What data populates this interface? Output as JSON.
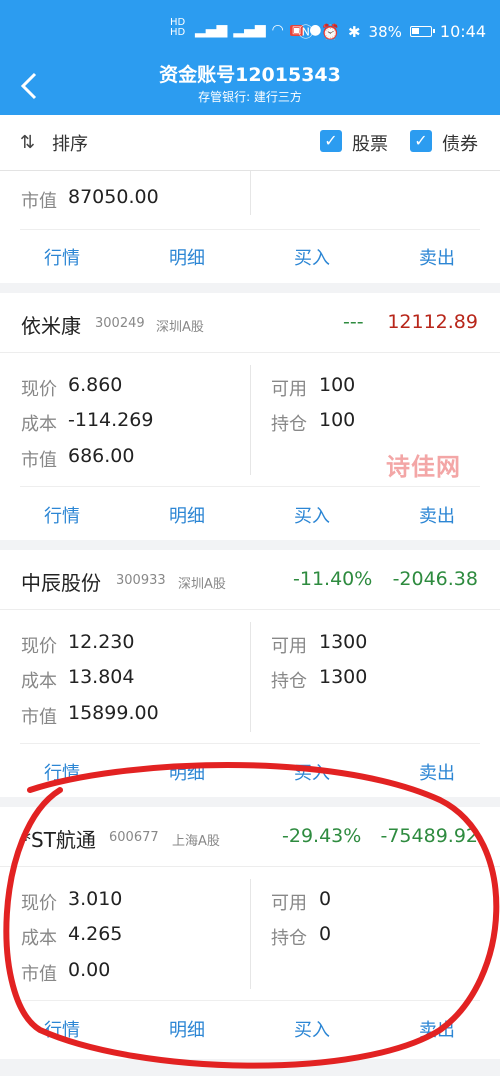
{
  "status_bar": {
    "network": "HD 5G 4G",
    "battery": "38%",
    "time": "10:44"
  },
  "header": {
    "title": "资金账号12015343",
    "subtitle": "存管银行: 建行三方"
  },
  "filter": {
    "sort_label": "排序",
    "stocks_label": "股票",
    "bonds_label": "债券"
  },
  "actions": {
    "quote": "行情",
    "detail": "明细",
    "buy": "买入",
    "sell": "卖出"
  },
  "labels": {
    "price": "现价",
    "cost": "成本",
    "market_value": "市值",
    "available": "可用",
    "holding": "持仓"
  },
  "partial_card": {
    "market_value": "87050.00"
  },
  "holdings": [
    {
      "name": "依米康",
      "code": "300249",
      "market": "深圳A股",
      "pct": "---",
      "profit": "12112.89",
      "price": "6.860",
      "cost": "-114.269",
      "market_value": "686.00",
      "available": "100",
      "holding": "100"
    },
    {
      "name": "中辰股份",
      "code": "300933",
      "market": "深圳A股",
      "pct": "-11.40%",
      "profit": "-2046.38",
      "price": "12.230",
      "cost": "13.804",
      "market_value": "15899.00",
      "available": "1300",
      "holding": "1300"
    },
    {
      "name": "*ST航通",
      "code": "600677",
      "market": "上海A股",
      "pct": "-29.43%",
      "profit": "-75489.92",
      "price": "3.010",
      "cost": "4.265",
      "market_value": "0.00",
      "available": "0",
      "holding": "0"
    }
  ],
  "watermark": "诗佳网",
  "colors": {
    "header_blue": "#2c9cf0",
    "loss_green": "#2e8b3f",
    "profit_red": "#b8261a",
    "action_blue": "#2c86d4"
  }
}
